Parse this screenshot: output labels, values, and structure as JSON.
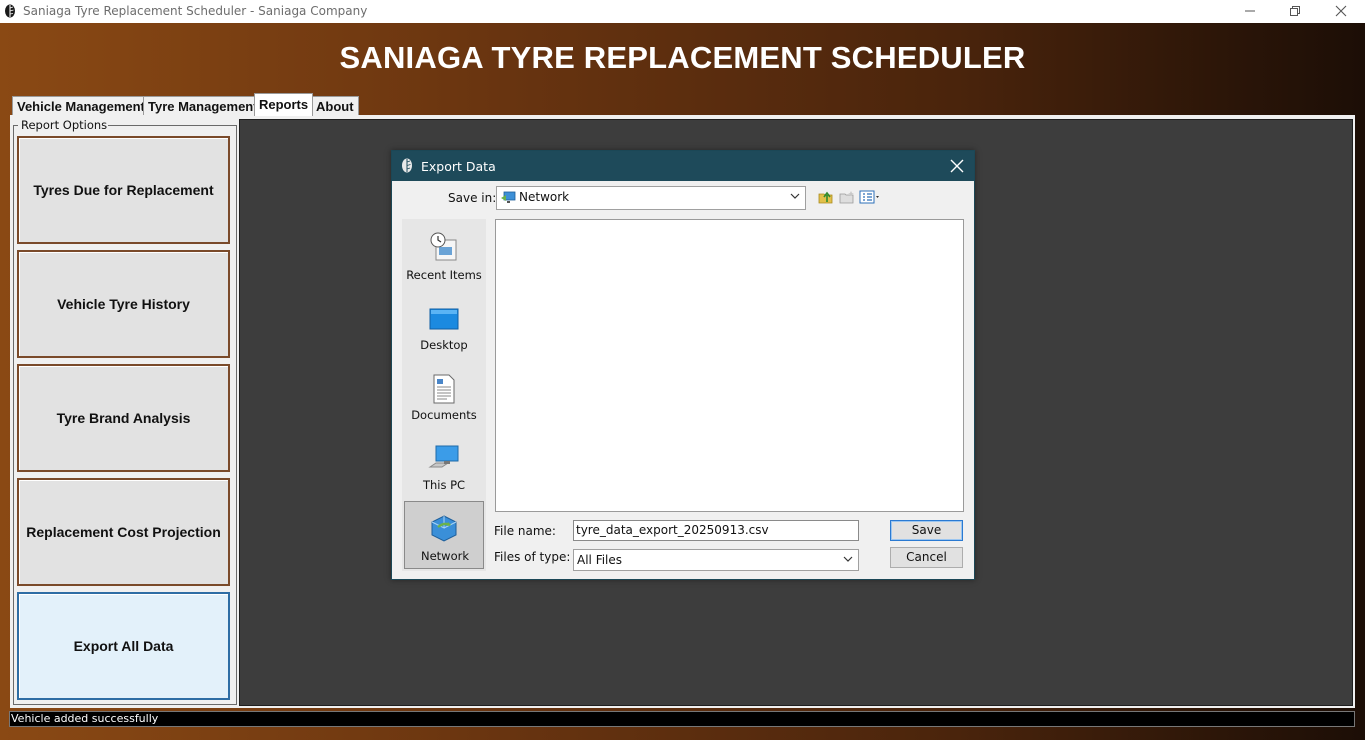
{
  "window": {
    "title": "Saniaga Tyre Replacement Scheduler - Saniaga Company",
    "controls": [
      "minimize",
      "restore",
      "close"
    ]
  },
  "app": {
    "header": "SANIAGA TYRE REPLACEMENT SCHEDULER",
    "tabs": [
      {
        "label": "Vehicle Management",
        "active": false
      },
      {
        "label": "Tyre Management",
        "active": false
      },
      {
        "label": "Reports",
        "active": true
      },
      {
        "label": "About",
        "active": false
      }
    ],
    "report_options": {
      "legend": "Report Options",
      "buttons": [
        {
          "label": "Tyres Due for Replacement",
          "selected": false
        },
        {
          "label": "Vehicle Tyre History",
          "selected": false
        },
        {
          "label": "Tyre Brand Analysis",
          "selected": false
        },
        {
          "label": "Replacement Cost Projection",
          "selected": false
        },
        {
          "label": "Export All Data",
          "selected": true
        }
      ]
    },
    "status": "Vehicle added successfully"
  },
  "dialog": {
    "title": "Export Data",
    "save_in_label": "Save in:",
    "save_in_value": "Network",
    "places": [
      {
        "label": "Recent Items",
        "icon": "recent-items-icon"
      },
      {
        "label": "Desktop",
        "icon": "desktop-icon"
      },
      {
        "label": "Documents",
        "icon": "documents-icon"
      },
      {
        "label": "This PC",
        "icon": "this-pc-icon"
      },
      {
        "label": "Network",
        "icon": "network-icon",
        "selected": true
      }
    ],
    "file_name_label": "File name:",
    "file_name_value": "tyre_data_export_20250913.csv",
    "files_of_type_label": "Files of type:",
    "files_of_type_value": "All Files",
    "save_label": "Save",
    "cancel_label": "Cancel"
  },
  "colors": {
    "dialog_title_bar": "#1e4a5a",
    "header_gradient_start": "#8a4914",
    "header_gradient_end": "#1c0e06",
    "selected_button_bg": "#e3f1fa",
    "button_border": "#7a4a2a"
  }
}
